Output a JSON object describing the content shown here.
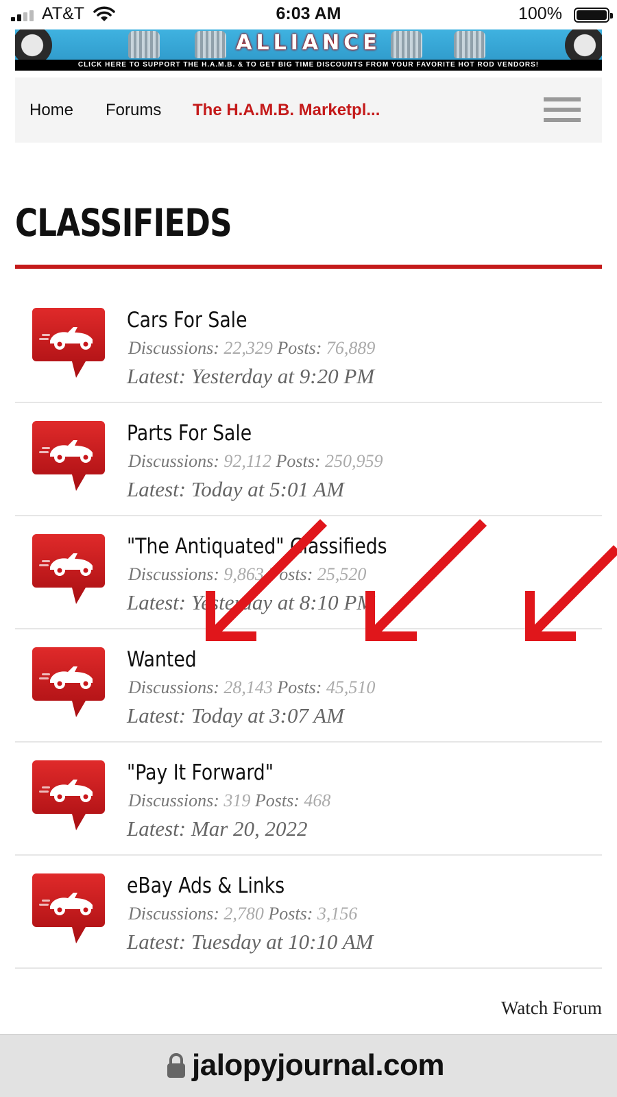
{
  "status_bar": {
    "carrier": "AT&T",
    "time": "6:03 AM",
    "battery": "100%"
  },
  "banner": {
    "title": "ALLIANCE",
    "tagline": "CLICK HERE TO SUPPORT THE H.A.M.B. & TO GET BIG TIME DISCOUNTS FROM YOUR FAVORITE HOT ROD VENDORS!"
  },
  "nav": {
    "home": "Home",
    "forums": "Forums",
    "marketplace": "The H.A.M.B. Marketpl..."
  },
  "page": {
    "title": "CLASSIFIEDS"
  },
  "labels": {
    "discussions": "Discussions:",
    "posts": "Posts:",
    "latest": "Latest:"
  },
  "forums": [
    {
      "name": "Cars For Sale",
      "discussions": "22,329",
      "posts": "76,889",
      "latest": "Yesterday at 9:20 PM"
    },
    {
      "name": "Parts For Sale",
      "discussions": "92,112",
      "posts": "250,959",
      "latest": "Today at 5:01 AM"
    },
    {
      "name": "\"The Antiquated\" Classifieds",
      "discussions": "9,863",
      "posts": "25,520",
      "latest": "Yesterday at 8:10 PM"
    },
    {
      "name": "Wanted",
      "discussions": "28,143",
      "posts": "45,510",
      "latest": "Today at 3:07 AM"
    },
    {
      "name": "\"Pay It Forward\"",
      "discussions": "319",
      "posts": "468",
      "latest": "Mar 20, 2022"
    },
    {
      "name": "eBay Ads & Links",
      "discussions": "2,780",
      "posts": "3,156",
      "latest": "Tuesday at 10:10 AM"
    }
  ],
  "footer": {
    "watch_forum": "Watch Forum"
  },
  "address_bar": {
    "url": "jalopyjournal.com"
  },
  "colors": {
    "accent": "#c41a1a",
    "icon_red": "#c8161b",
    "annotation": "#e0161b"
  }
}
